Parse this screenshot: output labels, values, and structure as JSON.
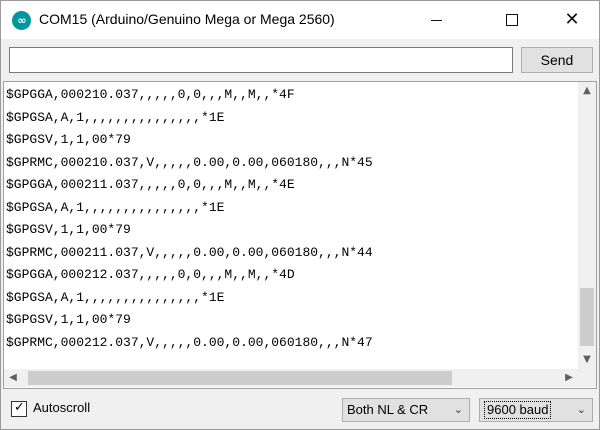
{
  "window": {
    "title": "COM15 (Arduino/Genuino Mega or Mega 2560)",
    "app_icon_glyph": "∞",
    "minimize_glyph": "",
    "maximize_glyph": "",
    "close_glyph": "✕"
  },
  "send": {
    "input_value": "",
    "button_label": "Send"
  },
  "output": {
    "lines": [
      "$GPGGA,000210.037,,,,,0,0,,,M,,M,,*4F",
      "$GPGSA,A,1,,,,,,,,,,,,,,,*1E",
      "$GPGSV,1,1,00*79",
      "$GPRMC,000210.037,V,,,,,0.00,0.00,060180,,,N*45",
      "$GPGGA,000211.037,,,,,0,0,,,M,,M,,*4E",
      "$GPGSA,A,1,,,,,,,,,,,,,,,*1E",
      "$GPGSV,1,1,00*79",
      "$GPRMC,000211.037,V,,,,,0.00,0.00,060180,,,N*44",
      "$GPGGA,000212.037,,,,,0,0,,,M,,M,,*4D",
      "$GPGSA,A,1,,,,,,,,,,,,,,,*1E",
      "$GPGSV,1,1,00*79",
      "$GPRMC,000212.037,V,,,,,0.00,0.00,060180,,,N*47"
    ]
  },
  "scrollbars": {
    "up_arrow": "▲",
    "down_arrow": "▼",
    "left_arrow": "◀",
    "right_arrow": "▶"
  },
  "footer": {
    "autoscroll_label": "Autoscroll",
    "autoscroll_checked": true,
    "checkmark": "✓",
    "line_ending_selected": "Both NL & CR",
    "baud_selected": "9600 baud",
    "dropdown_chevron": "⌄"
  },
  "colors": {
    "arduino_teal": "#00979c",
    "window_bg": "#f0f0f0",
    "button_bg": "#e1e1e1"
  }
}
